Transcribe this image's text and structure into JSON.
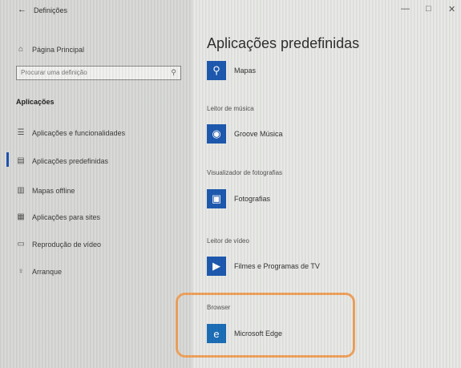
{
  "window": {
    "title": "Definições",
    "back_glyph": "←",
    "minimize_glyph": "—",
    "maximize_glyph": "□",
    "close_glyph": "✕"
  },
  "sidebar": {
    "home": {
      "label": "Página Principal",
      "icon": "home-icon"
    },
    "search": {
      "placeholder": "Procurar uma definição"
    },
    "section_title": "Aplicações",
    "items": [
      {
        "label": "Aplicações e funcionalidades",
        "icon": "list-icon",
        "active": false
      },
      {
        "label": "Aplicações predefinidas",
        "icon": "defaults-icon",
        "active": true
      },
      {
        "label": "Mapas offline",
        "icon": "map-icon",
        "active": false
      },
      {
        "label": "Aplicações para sites",
        "icon": "web-icon",
        "active": false
      },
      {
        "label": "Reprodução de vídeo",
        "icon": "video-icon",
        "active": false
      },
      {
        "label": "Arranque",
        "icon": "startup-icon",
        "active": false
      }
    ]
  },
  "main": {
    "title": "Aplicações predefinidas",
    "sections": [
      {
        "category": "",
        "app": "Mapas",
        "icon": "maps-icon"
      },
      {
        "category": "Leitor de música",
        "app": "Groove Música",
        "icon": "groove-icon"
      },
      {
        "category": "Visualizador de fotografias",
        "app": "Fotografias",
        "icon": "photos-icon"
      },
      {
        "category": "Leitor de vídeo",
        "app": "Filmes e Programas de TV",
        "icon": "films-icon"
      },
      {
        "category": "Browser",
        "app": "Microsoft Edge",
        "icon": "edge-icon"
      }
    ]
  },
  "colors": {
    "accent": "#1e5ab0",
    "highlight": "#f0a35e"
  }
}
